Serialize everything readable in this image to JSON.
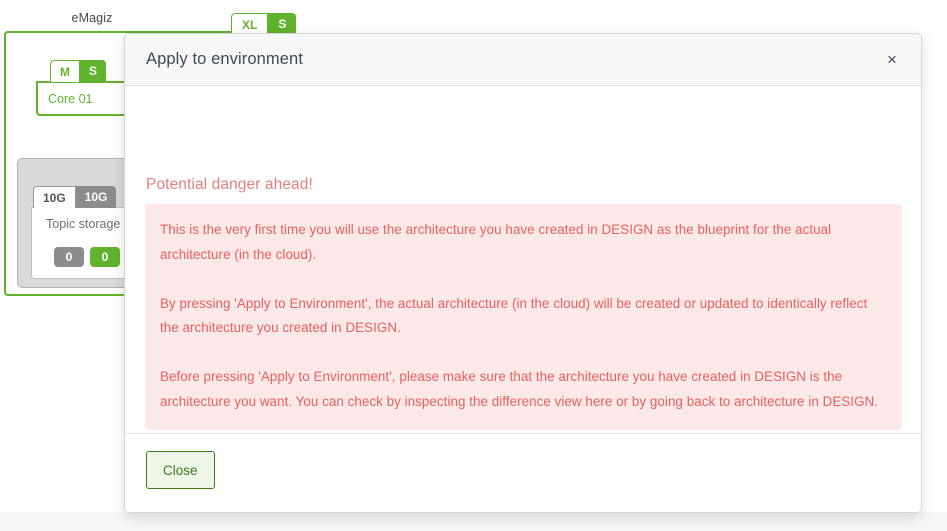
{
  "background": {
    "environment_label": "eMagiz",
    "top_badge": {
      "left": "XL",
      "right": "S"
    },
    "machine": {
      "badge_left": "M",
      "badge_right": "S",
      "name": "Core 01"
    },
    "storage": {
      "badge_left": "10G",
      "badge_right": "10G",
      "name": "Topic storage",
      "count_left": "0",
      "count_right": "0"
    },
    "colors": {
      "green": "#61b22c",
      "grey": "#8c8c8c"
    }
  },
  "modal": {
    "title": "Apply to environment",
    "close_icon": "close-icon",
    "close_glyph": "×",
    "danger_heading": "Potential danger ahead!",
    "alert": {
      "bg_color": "#fbe9e9",
      "text_color": "#e8615c",
      "paragraphs": [
        "This is the very first time you will use the architecture you have created in DESIGN as the blueprint for the actual architecture (in the cloud).",
        "By pressing 'Apply to Environment', the actual architecture (in the cloud) will be created or updated to identically reflect the architecture you created in DESIGN.",
        "Before pressing 'Apply to Environment', please make sure that the architecture you have created in DESIGN is the architecture you want. You can check by inspecting the difference view here or by going back to architecture in DESIGN."
      ]
    },
    "footer": {
      "close_button_label": "Close",
      "close_button_color": "#3e7a1f"
    }
  }
}
